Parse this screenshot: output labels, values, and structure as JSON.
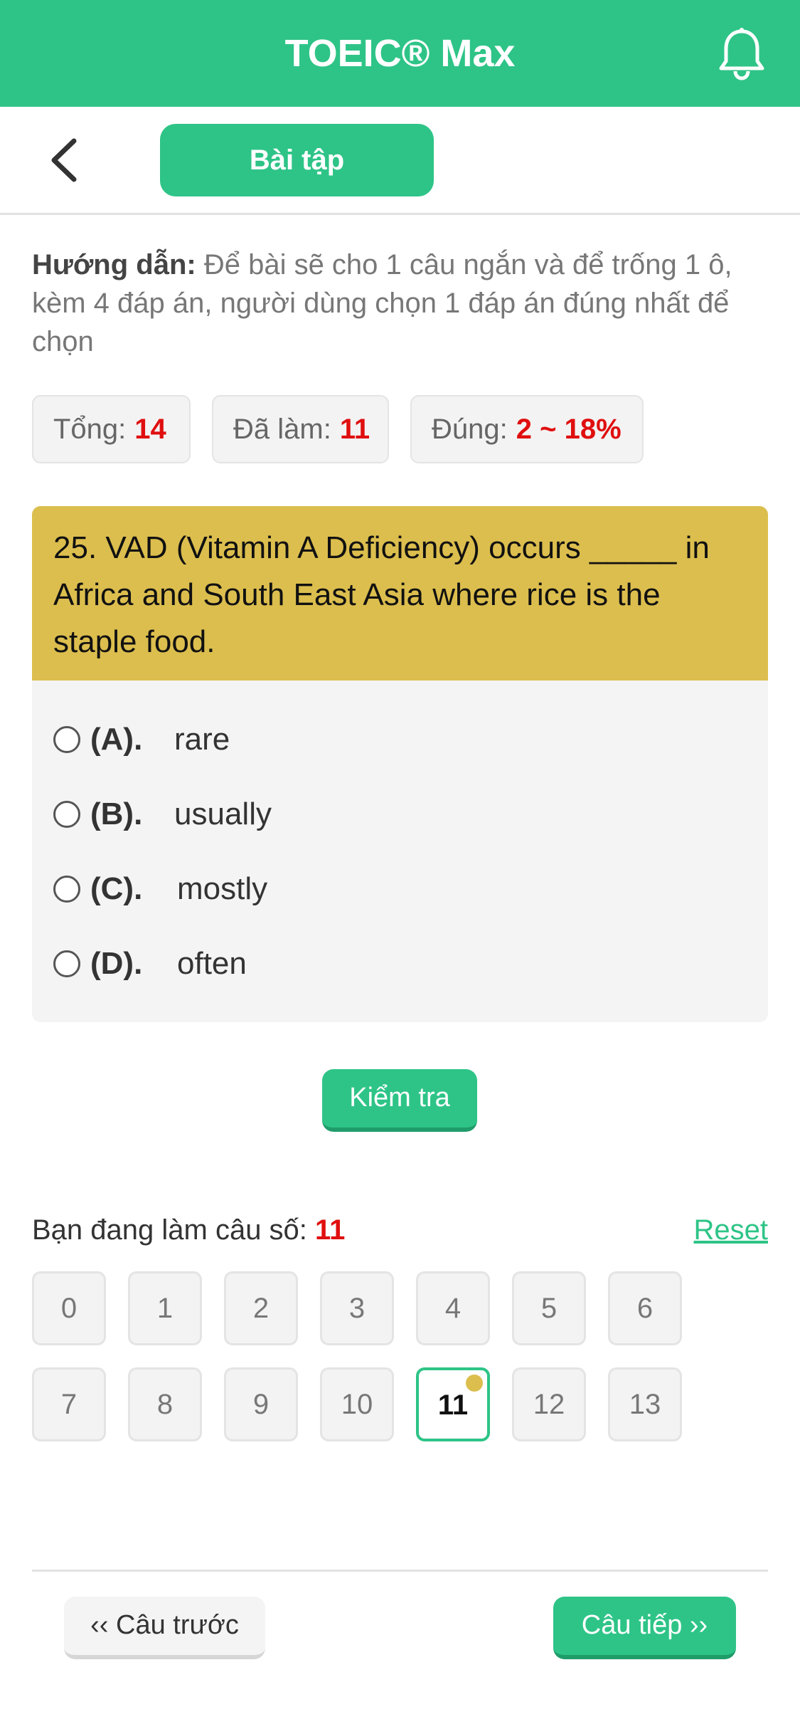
{
  "header": {
    "title": "TOEIC® Max",
    "bell_icon": "bell-icon"
  },
  "subbar": {
    "back_icon": "chevron-left-icon",
    "tab_label": "Bài tập"
  },
  "instructions": {
    "label": "Hướng dẫn:",
    "text": "Để bài sẽ cho 1 câu ngắn và để trống 1 ô, kèm 4 đáp án, người dùng chọn 1 đáp án đúng nhất để chọn"
  },
  "stats": {
    "total_label": "Tổng:",
    "total_value": "14",
    "done_label": "Đã làm:",
    "done_value": "11",
    "correct_label": "Đúng:",
    "correct_value": "2 ~ 18%"
  },
  "question": {
    "text": "25. VAD (Vitamin A Deficiency) occurs _____ in Africa and South East Asia where rice is the staple food.",
    "options": [
      {
        "letter": "(A).",
        "text": "rare"
      },
      {
        "letter": "(B).",
        "text": "usually"
      },
      {
        "letter": "(C).",
        "text": "mostly"
      },
      {
        "letter": "(D).",
        "text": "often"
      }
    ]
  },
  "check_button": "Kiểm tra",
  "progress": {
    "label": "Bạn đang làm câu số:",
    "current": "11",
    "reset": "Reset"
  },
  "question_numbers": [
    "0",
    "1",
    "2",
    "3",
    "4",
    "5",
    "6",
    "7",
    "8",
    "9",
    "10",
    "11",
    "12",
    "13"
  ],
  "navigation": {
    "prev": "‹‹ Câu trước",
    "next": "Câu tiếp ››"
  },
  "colors": {
    "brand_green": "#2ec487",
    "highlight_yellow": "#dcbe4e",
    "value_red": "#e00f0f"
  }
}
